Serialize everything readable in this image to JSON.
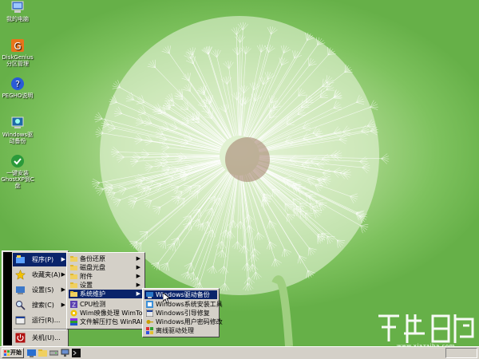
{
  "desktop": {
    "icons": [
      {
        "label": "我的电脑",
        "icon": "computer-icon"
      },
      {
        "label": "DiskGenius分区管理",
        "icon": "diskgenius-icon"
      },
      {
        "label": "PEGHO说明",
        "icon": "help-icon"
      },
      {
        "label": "Windows驱动备份",
        "icon": "driver-backup-icon"
      },
      {
        "label": "一键安装GhostXP到C盘",
        "icon": "install-icon"
      }
    ]
  },
  "start_menu": {
    "items": [
      {
        "label": "程序(P)",
        "icon": "programs-icon",
        "submenu": true,
        "selected": true
      },
      {
        "label": "收藏夹(A)",
        "icon": "favorites-icon",
        "submenu": true
      },
      {
        "label": "设置(S)",
        "icon": "settings-icon",
        "submenu": true
      },
      {
        "label": "搜索(C)",
        "icon": "search-icon",
        "submenu": true
      },
      {
        "label": "运行(R)...",
        "icon": "run-icon"
      },
      {
        "label": "关机(U)...",
        "icon": "shutdown-icon"
      }
    ]
  },
  "programs_menu": {
    "items": [
      {
        "label": "备份还原",
        "icon": "folder-icon",
        "submenu": true
      },
      {
        "label": "磁盘光盘",
        "icon": "folder-icon",
        "submenu": true
      },
      {
        "label": "附件",
        "icon": "folder-icon",
        "submenu": true
      },
      {
        "label": "设置",
        "icon": "folder-icon",
        "submenu": true
      },
      {
        "label": "系统维护",
        "icon": "folder-icon",
        "submenu": true,
        "selected": true
      },
      {
        "label": "CPU检测",
        "icon": "cpu-z-icon"
      },
      {
        "label": "Wim映像处理 WimTool",
        "icon": "wimtool-icon"
      },
      {
        "label": "文件解压打包 WinRAR",
        "icon": "winrar-icon"
      }
    ]
  },
  "maintenance_menu": {
    "items": [
      {
        "label": "Windows驱动备份",
        "icon": "driver-backup-icon",
        "selected": true
      },
      {
        "label": "Windows系统安装工具",
        "icon": "install-tool-icon"
      },
      {
        "label": "Windows引导修复",
        "icon": "boot-repair-icon"
      },
      {
        "label": "Windows用户密码修改",
        "icon": "password-icon"
      },
      {
        "label": "离线驱动处理",
        "icon": "offline-driver-icon"
      }
    ]
  },
  "taskbar": {
    "start_label": "开始",
    "quick_launch": [
      "desktop-icon",
      "explorer-icon",
      "drive-icon",
      "network-icon",
      "terminal-icon"
    ]
  },
  "watermark": {
    "text": "www.xiazaiba.com"
  },
  "colors": {
    "selection": "#0a246a",
    "menu_face": "#d4d0c8",
    "desktop_green": "#7ec25e"
  }
}
